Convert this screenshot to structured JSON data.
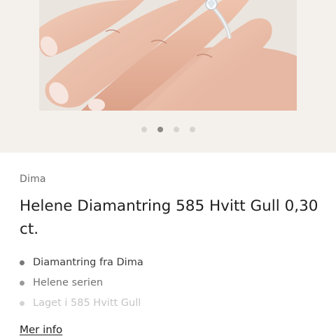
{
  "product": {
    "brand": "Dima",
    "title": "Helene Diamantring 585 Hvitt Gull 0,30 ct.",
    "features": [
      "Diamantring fra Dima",
      "Helene serien",
      "Laget i 585 Hvitt Gull"
    ],
    "more_info_label": "Mer info"
  },
  "gallery": {
    "image_count": 4,
    "active_index": 1,
    "image_subject": "hand-wearing-diamond-ring"
  },
  "colors": {
    "gallery_background": "#f4f1ec",
    "dot_inactive": "#d6d3cf",
    "dot_active": "#8c8a87",
    "text_primary": "#1f1f1f",
    "text_secondary": "#6b6b6b"
  }
}
